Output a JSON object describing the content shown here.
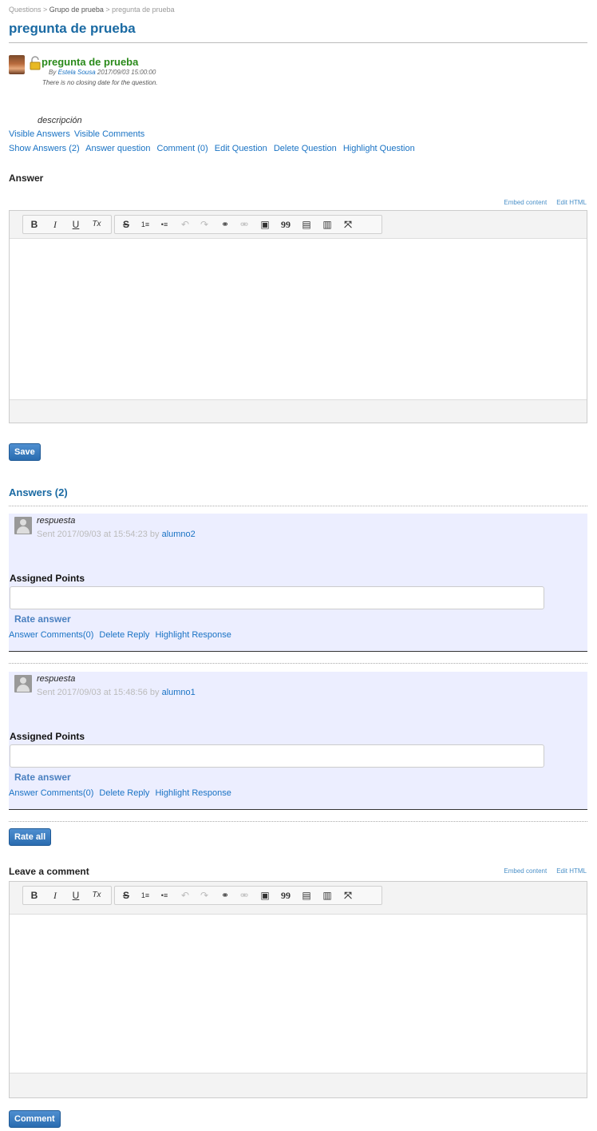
{
  "breadcrumb": {
    "root": "Questions",
    "sep1": " > ",
    "group": "Grupo de prueba",
    "sep2": " > ",
    "current": "pregunta de prueba"
  },
  "page_title": "pregunta de prueba",
  "question": {
    "title": "pregunta de prueba",
    "by_label": "By ",
    "author": "Estela Sousa",
    "date": " 2017/09/03 15:00:00",
    "closing": "There is no closing date for the question.",
    "description": "descripción",
    "visibility": [
      "Visible Answers",
      "Visible Comments"
    ],
    "actions": [
      "Show Answers (2)",
      "Answer question",
      "Comment (0)",
      "Edit Question",
      "Delete Question",
      "Highlight Question"
    ]
  },
  "answer_section": {
    "label": "Answer",
    "embed": "Embed content",
    "edit_html": "Edit HTML",
    "save": "Save"
  },
  "toolbar": {
    "bold": "B",
    "italic": "I",
    "underline": "U",
    "clear": "Tx",
    "strike": "S",
    "ol": "1≡",
    "ul": "•≡",
    "undo": "↶",
    "redo": "↷",
    "link": "⚭",
    "unlink": "⚮",
    "image": "▣",
    "quote": "99",
    "paste": "▤",
    "paste_word": "▥",
    "max": "⤧"
  },
  "answers": {
    "title": "Answers (2)",
    "items": [
      {
        "text": "respuesta",
        "meta": "Sent 2017/09/03 at 15:54:23 by ",
        "user": "alumno2",
        "points_label": "Assigned Points",
        "rate": "Rate answer",
        "actions": [
          "Answer Comments(0)",
          "Delete Reply",
          "Highlight Response"
        ]
      },
      {
        "text": "respuesta",
        "meta": "Sent 2017/09/03 at 15:48:56 by ",
        "user": "alumno1",
        "points_label": "Assigned Points",
        "rate": "Rate answer",
        "actions": [
          "Answer Comments(0)",
          "Delete Reply",
          "Highlight Response"
        ]
      }
    ],
    "rate_all": "Rate all"
  },
  "comment_section": {
    "label": "Leave a comment",
    "embed": "Embed content",
    "edit_html": "Edit HTML",
    "submit": "Comment"
  }
}
